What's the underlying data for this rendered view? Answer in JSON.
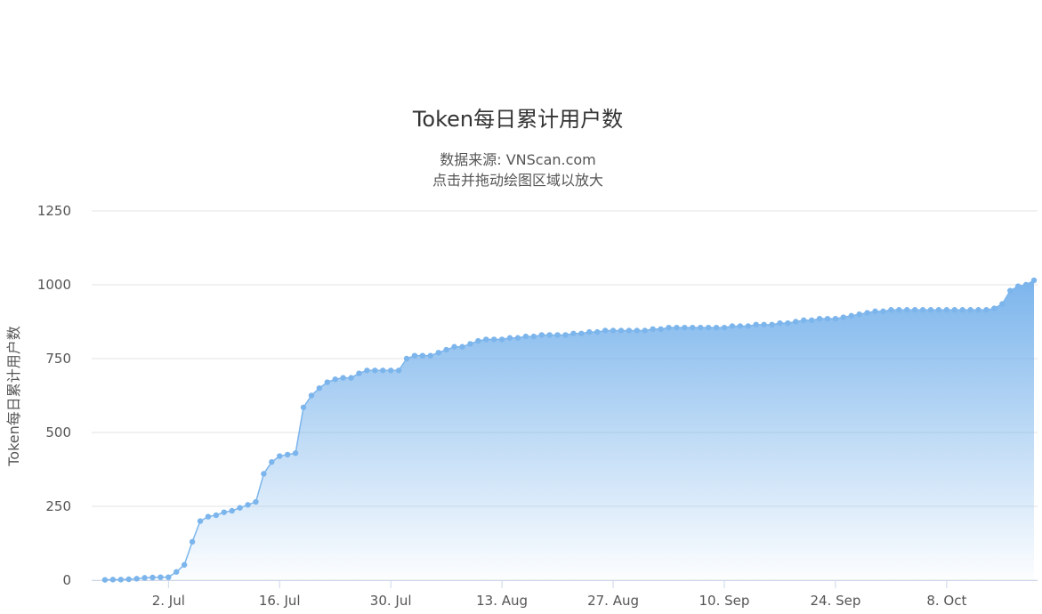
{
  "chart_data": {
    "type": "area",
    "title": "Token每日累计用户数",
    "subtitle_line1": "数据来源: VNScan.com",
    "subtitle_line2": "点击并拖动绘图区域以放大",
    "ylabel": "Token每日累计用户数",
    "ylim": [
      0,
      1250
    ],
    "yticks": [
      0,
      250,
      500,
      750,
      1000,
      1250
    ],
    "x_start": "2018-06-23",
    "x_end": "2018-10-19",
    "x_ticks": [
      {
        "date": "2018-07-02",
        "label": "2. Jul"
      },
      {
        "date": "2018-07-16",
        "label": "16. Jul"
      },
      {
        "date": "2018-07-30",
        "label": "30. Jul"
      },
      {
        "date": "2018-08-13",
        "label": "13. Aug"
      },
      {
        "date": "2018-08-27",
        "label": "27. Aug"
      },
      {
        "date": "2018-09-10",
        "label": "10. Sep"
      },
      {
        "date": "2018-09-24",
        "label": "24. Sep"
      },
      {
        "date": "2018-10-08",
        "label": "8. Oct"
      }
    ],
    "series": [
      {
        "color": "#7cb5ec",
        "dates": [
          "2018-06-24",
          "2018-06-25",
          "2018-06-26",
          "2018-06-27",
          "2018-06-28",
          "2018-06-29",
          "2018-06-30",
          "2018-07-01",
          "2018-07-02",
          "2018-07-03",
          "2018-07-04",
          "2018-07-05",
          "2018-07-06",
          "2018-07-07",
          "2018-07-08",
          "2018-07-09",
          "2018-07-10",
          "2018-07-11",
          "2018-07-12",
          "2018-07-13",
          "2018-07-14",
          "2018-07-15",
          "2018-07-16",
          "2018-07-17",
          "2018-07-18",
          "2018-07-19",
          "2018-07-20",
          "2018-07-21",
          "2018-07-22",
          "2018-07-23",
          "2018-07-24",
          "2018-07-25",
          "2018-07-26",
          "2018-07-27",
          "2018-07-28",
          "2018-07-29",
          "2018-07-30",
          "2018-07-31",
          "2018-08-01",
          "2018-08-02",
          "2018-08-03",
          "2018-08-04",
          "2018-08-05",
          "2018-08-06",
          "2018-08-07",
          "2018-08-08",
          "2018-08-09",
          "2018-08-10",
          "2018-08-11",
          "2018-08-12",
          "2018-08-13",
          "2018-08-14",
          "2018-08-15",
          "2018-08-16",
          "2018-08-17",
          "2018-08-18",
          "2018-08-19",
          "2018-08-20",
          "2018-08-21",
          "2018-08-22",
          "2018-08-23",
          "2018-08-24",
          "2018-08-25",
          "2018-08-26",
          "2018-08-27",
          "2018-08-28",
          "2018-08-29",
          "2018-08-30",
          "2018-08-31",
          "2018-09-01",
          "2018-09-02",
          "2018-09-03",
          "2018-09-04",
          "2018-09-05",
          "2018-09-06",
          "2018-09-07",
          "2018-09-08",
          "2018-09-09",
          "2018-09-10",
          "2018-09-11",
          "2018-09-12",
          "2018-09-13",
          "2018-09-14",
          "2018-09-15",
          "2018-09-16",
          "2018-09-17",
          "2018-09-18",
          "2018-09-19",
          "2018-09-20",
          "2018-09-21",
          "2018-09-22",
          "2018-09-23",
          "2018-09-24",
          "2018-09-25",
          "2018-09-26",
          "2018-09-27",
          "2018-09-28",
          "2018-09-29",
          "2018-09-30",
          "2018-10-01",
          "2018-10-02",
          "2018-10-03",
          "2018-10-04",
          "2018-10-05",
          "2018-10-06",
          "2018-10-07",
          "2018-10-08",
          "2018-10-09",
          "2018-10-10",
          "2018-10-11",
          "2018-10-12",
          "2018-10-13",
          "2018-10-14",
          "2018-10-15",
          "2018-10-16",
          "2018-10-17",
          "2018-10-18",
          "2018-10-19"
        ],
        "values": [
          1,
          2,
          2,
          3,
          5,
          8,
          9,
          10,
          10,
          28,
          52,
          130,
          200,
          215,
          220,
          230,
          235,
          245,
          255,
          265,
          360,
          400,
          420,
          425,
          430,
          585,
          625,
          650,
          670,
          680,
          685,
          685,
          700,
          710,
          710,
          710,
          710,
          710,
          750,
          760,
          760,
          760,
          770,
          780,
          790,
          790,
          800,
          810,
          815,
          815,
          815,
          820,
          820,
          825,
          825,
          830,
          830,
          830,
          830,
          835,
          835,
          840,
          840,
          845,
          845,
          845,
          845,
          845,
          845,
          850,
          850,
          855,
          855,
          855,
          855,
          855,
          855,
          855,
          855,
          860,
          860,
          860,
          865,
          865,
          865,
          870,
          870,
          875,
          880,
          880,
          885,
          885,
          885,
          890,
          895,
          900,
          905,
          910,
          910,
          915,
          915,
          915,
          915,
          915,
          915,
          915,
          915,
          915,
          915,
          915,
          915,
          915,
          920,
          935,
          980,
          995,
          1000,
          1015
        ]
      }
    ]
  }
}
